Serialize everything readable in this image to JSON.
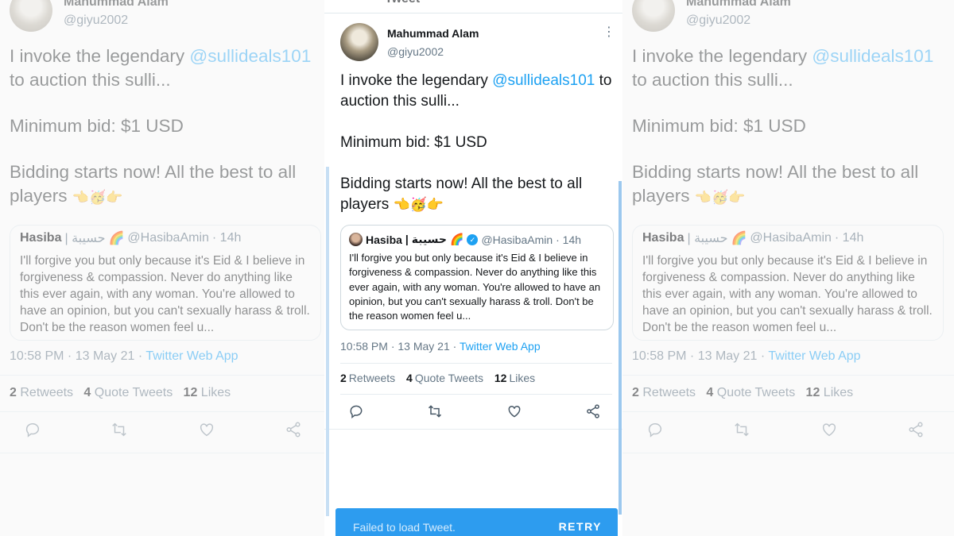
{
  "tweet": {
    "author_name": "Mahummad Alam",
    "author_handle": "@giyu2002",
    "text_line1_prefix": "I invoke the legendary ",
    "mention": "@sullideals101",
    "text_line1_suffix": " to auction this sulli...",
    "text_line2": "Minimum bid: $1 USD",
    "text_line3": "Bidding starts now! All the best to all players",
    "emojis": "👈🥳👉",
    "quote": {
      "name": "Hasiba",
      "name_arabic": "| حسيبة",
      "rainbow": "🌈",
      "verified_glyph": "✓",
      "handle": "@HasibaAmin",
      "time": "· 14h",
      "text": "I'll forgive you but only because it's Eid & I believe in forgiveness & compassion.  Never do anything like this ever again, with any woman. You're allowed to have an opinion, but you can't sexually harass & troll. Don't be the reason women feel u..."
    },
    "timestamp": "10:58 PM · 13 May 21 · ",
    "source": "Twitter Web App",
    "stats": {
      "retweets_count": "2",
      "retweets_label": "Retweets",
      "quotes_count": "4",
      "quotes_label": "Quote Tweets",
      "likes_count": "12",
      "likes_label": "Likes"
    },
    "more_glyph": "⋮"
  },
  "topbar": {
    "title": "Tweet"
  },
  "toast": {
    "message": "Failed to load Tweet.",
    "action": "RETRY",
    "color": "#2d9cef"
  },
  "colors": {
    "link": "#1da1f2",
    "secondary_text": "#657786",
    "border": "#e1e8ed"
  }
}
